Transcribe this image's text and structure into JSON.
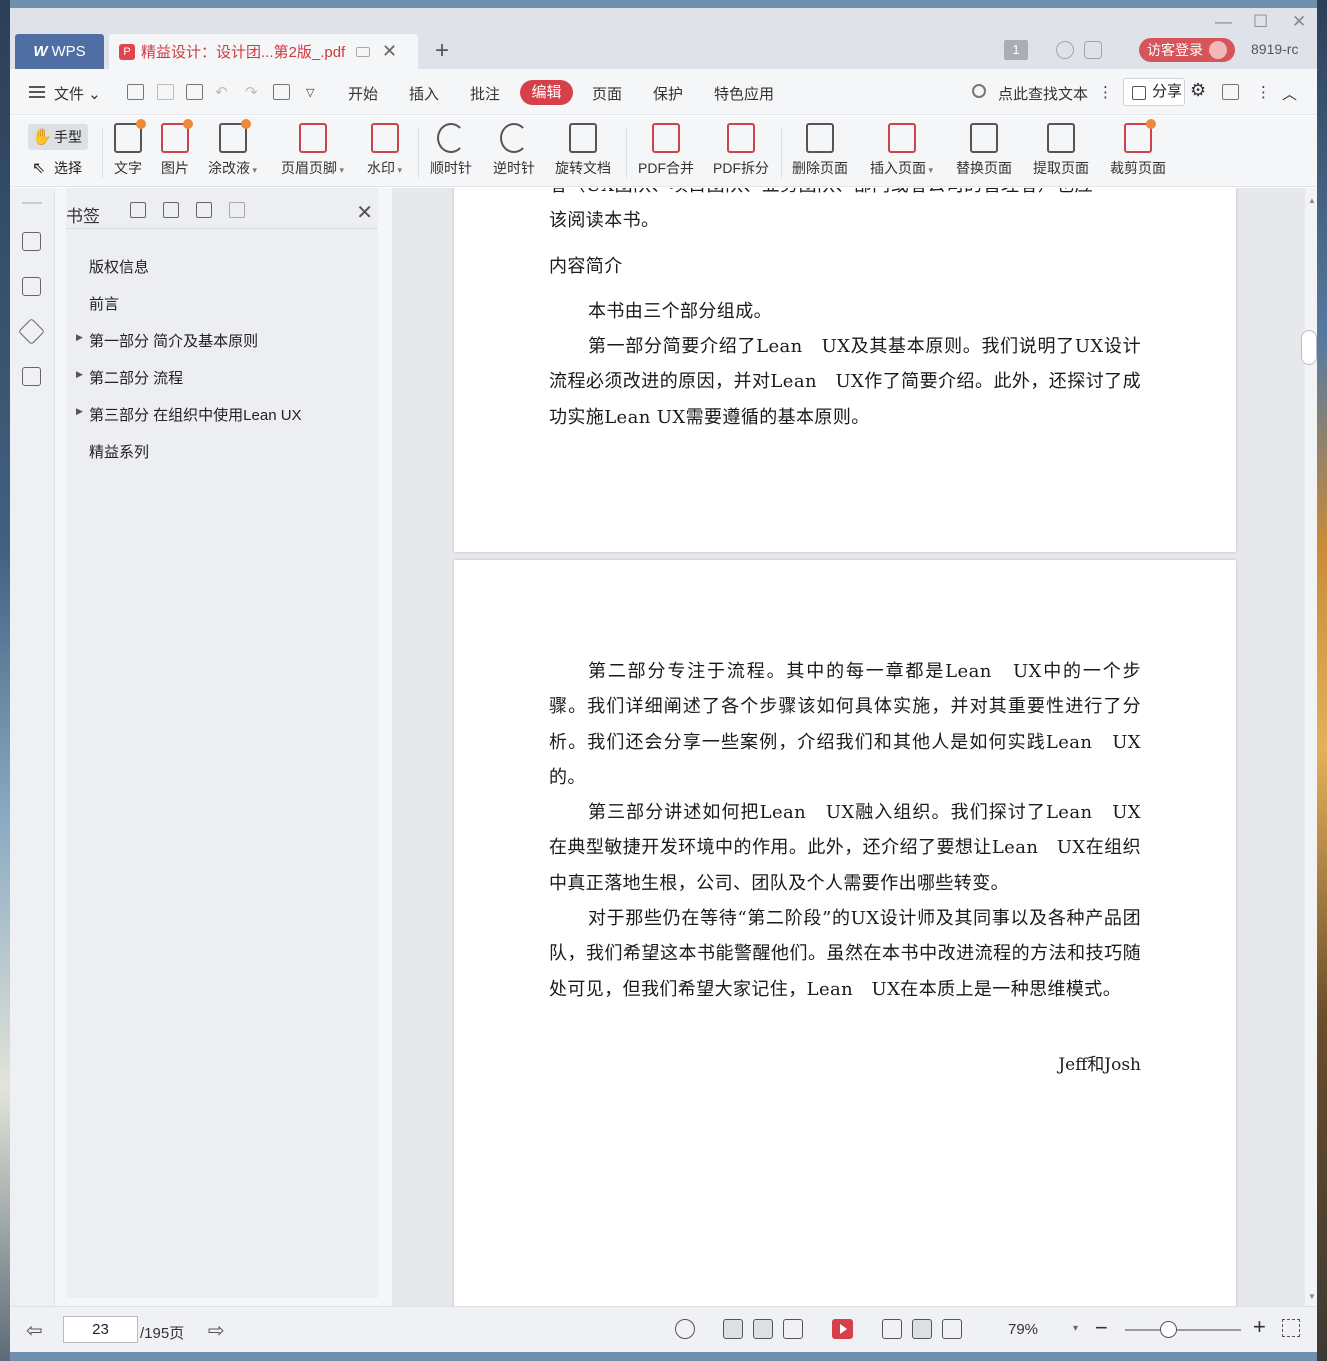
{
  "titlebar": {
    "app_tab": "WPS",
    "doc_tab_title": "精益设计：设计团...第2版_.pdf",
    "page_badge": "1",
    "login_label": "访客登录",
    "version": "8919-rc"
  },
  "menubar": {
    "file_label": "文件",
    "items": [
      "开始",
      "插入",
      "批注",
      "编辑",
      "页面",
      "保护",
      "特色应用"
    ],
    "active_item": "编辑",
    "search_label": "点此查找文本",
    "share_label": "分享"
  },
  "toolbar": {
    "hand_label": "手型",
    "select_label": "选择",
    "tools": [
      "文字",
      "图片",
      "涂改液",
      "页眉页脚",
      "水印",
      "顺时针",
      "逆时针",
      "旋转文档",
      "PDF合并",
      "PDF拆分",
      "删除页面",
      "插入页面",
      "替换页面",
      "提取页面",
      "裁剪页面"
    ]
  },
  "bookmarks": {
    "title": "书签",
    "items": [
      {
        "label": "版权信息",
        "expandable": false
      },
      {
        "label": "前言",
        "expandable": false
      },
      {
        "label": "第一部分 简介及基本原则",
        "expandable": true
      },
      {
        "label": "第二部分 流程",
        "expandable": true
      },
      {
        "label": "第三部分 在组织中使用Lean UX",
        "expandable": true
      },
      {
        "label": "精益系列",
        "expandable": false
      }
    ]
  },
  "page1": {
    "cut_line": "者（UX团队、项目团队、业务团队、部门或者公司的管理者）也应",
    "p0": "该阅读本书。",
    "heading": "内容简介",
    "p1": "本书由三个部分组成。",
    "p2": "第一部分简要介绍了Lean　UX及其基本原则。我们说明了UX设计流程必须改进的原因，并对Lean　UX作了简要介绍。此外，还探讨了成功实施Lean UX需要遵循的基本原则。"
  },
  "page2": {
    "p1": "第二部分专注于流程。其中的每一章都是Lean　UX中的一个步骤。我们详细阐述了各个步骤该如何具体实施，并对其重要性进行了分析。我们还会分享一些案例，介绍我们和其他人是如何实践Lean　UX的。",
    "p2": "第三部分讲述如何把Lean　UX融入组织。我们探讨了Lean　UX在典型敏捷开发环境中的作用。此外，还介绍了要想让Lean　UX在组织中真正落地生根，公司、团队及个人需要作出哪些转变。",
    "p3": "对于那些仍在等待“第二阶段”的UX设计师及其同事以及各种产品团队，我们希望这本书能警醒他们。虽然在本书中改进流程的方法和技巧随处可见，但我们希望大家记住，Lean　UX在本质上是一种思维模式。",
    "signature": "Jeff和Josh"
  },
  "status": {
    "current_page": "23",
    "total_pages": "/195页",
    "zoom": "79%"
  },
  "colors": {
    "accent": "#d6404a",
    "wps_tab": "#4f6ea3"
  }
}
